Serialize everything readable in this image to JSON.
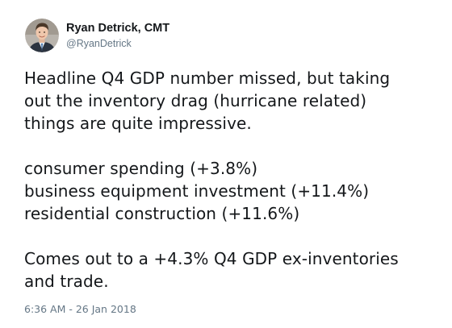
{
  "author": {
    "display_name": "Ryan Detrick, CMT",
    "handle": "@RyanDetrick",
    "avatar_icon": "user-profile-photo"
  },
  "tweet": {
    "lines": [
      "Headline Q4 GDP number missed, but taking",
      "out the inventory drag (hurricane related)",
      "things are quite impressive.",
      "consumer spending (+3.8%)",
      "business equipment investment (+11.4%)",
      "residential construction (+11.6%)",
      "Comes out to a +4.3% Q4 GDP ex-inventories",
      "and trade."
    ],
    "timestamp": "6:36 AM - 26 Jan 2018"
  },
  "colors": {
    "name": "#14171a",
    "secondary": "#657786",
    "background": "#ffffff"
  }
}
